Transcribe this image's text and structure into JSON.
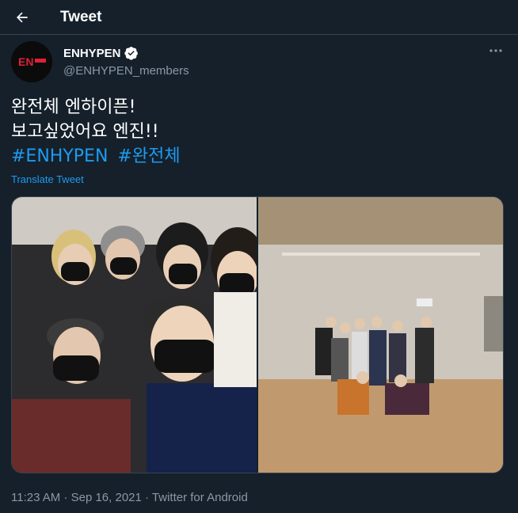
{
  "header": {
    "title": "Tweet"
  },
  "author": {
    "display_name": "ENHYPEN",
    "handle": "@ENHYPEN_members",
    "avatar_text": "EN-",
    "verified": true
  },
  "tweet": {
    "line1": "완전체 엔하이픈!",
    "line2": "보고싶었어요 엔진!!",
    "hashtags": [
      "#ENHYPEN",
      "#완전체"
    ],
    "translate_label": "Translate Tweet"
  },
  "meta": {
    "time": "11:23 AM",
    "sep1": " · ",
    "date": "Sep 16, 2021",
    "sep2": " · ",
    "client": "Twitter for Android"
  },
  "colors": {
    "background": "#15202b",
    "accent": "#1d9bf0",
    "secondary_text": "#8b98a5",
    "border": "#38444d",
    "brand_red": "#e0203a"
  },
  "icons": {
    "back": "arrow-left-icon",
    "verified": "verified-badge-icon",
    "more": "more-horizontal-icon"
  }
}
